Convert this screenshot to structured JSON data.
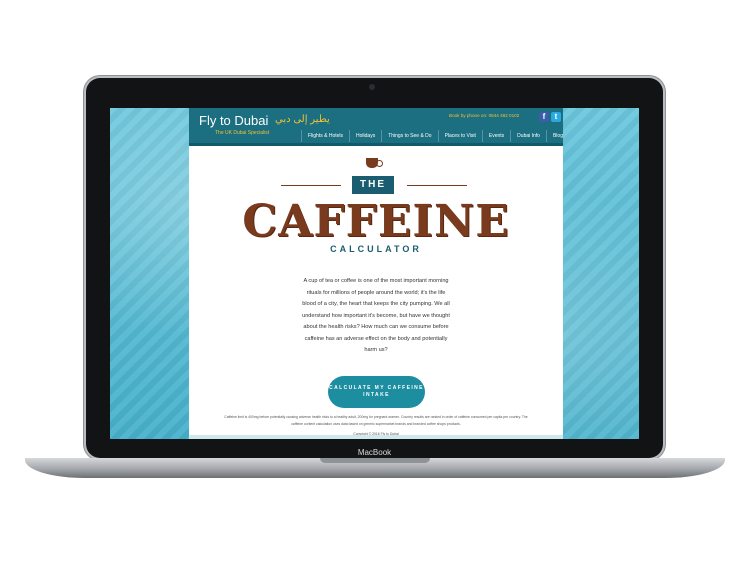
{
  "device": {
    "bezel_label": "MacBook"
  },
  "site": {
    "logo": "Fly to Dubai",
    "logo_arabic": "يطير إلى دبي",
    "tagline": "The UK Dubai Specialist",
    "phone": "Book by phone on: 0844 482 0102",
    "social": {
      "facebook": "f",
      "twitter": "t"
    },
    "nav": [
      "Flights & Hotels",
      "Holidays",
      "Things to See & Do",
      "Places to Visit",
      "Events",
      "Dubai Info",
      "Blog"
    ]
  },
  "hero": {
    "the_label": "THE",
    "title": "CAFFEINE",
    "subtitle": "CALCULATOR",
    "intro": "A cup of tea or coffee is one of the most important morning rituals for millions of people around the world; it's the life blood of a city, the heart that keeps the city pumping. We all understand how important it's become, but have we thought about the health risks? How much can we consume before caffeine has an adverse effect on the body and potentially harm us?",
    "cta": "CALCULATE MY CAFFEINE INTAKE"
  },
  "footer": {
    "disclaimer": "Caffeine limit is 400mg before potentially causing adverse health risks to a healthy adult, 200mg for pregnant women. Country results are ranked in order of caffeine consumed per capita per country. The caffeine content calculation uses data based on generic supermarket brands and branded coffee shops products.",
    "copyright": "Copyright © 2016 Fly to Dubai"
  },
  "colors": {
    "accent": "#1b6f81",
    "brand_brown": "#7a3a1d",
    "cta": "#1d8ea0",
    "highlight": "#f1c232"
  },
  "icons": [
    "coffee-cup-icon",
    "facebook-icon",
    "twitter-icon"
  ]
}
